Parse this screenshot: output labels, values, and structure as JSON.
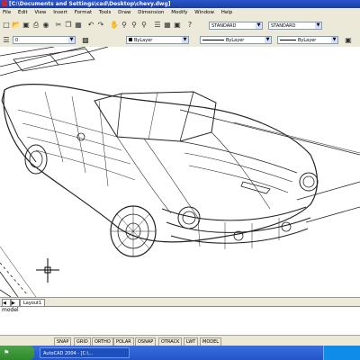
{
  "window": {
    "title": "[C:\\Documents and Settings\\cad\\Desktop\\chevy.dwg]"
  },
  "menu": {
    "items": [
      "File",
      "Edit",
      "View",
      "Insert",
      "Format",
      "Tools",
      "Draw",
      "Dimension",
      "Modify",
      "Window",
      "Help"
    ]
  },
  "toolbar": {
    "text_style": "STANDARD",
    "dim_style": "STANDARD",
    "layer": "0",
    "color": "ByLayer",
    "linetype": "ByLayer",
    "lineweight": "ByLayer"
  },
  "layout_tabs": [
    "Layout1"
  ],
  "command_line": {
    "text": "model"
  },
  "status": {
    "buttons": [
      "SNAP",
      "GRID",
      "ORTHO",
      "POLAR",
      "OSNAP",
      "OTRACK",
      "LWT",
      "MODEL"
    ]
  },
  "taskbar": {
    "item": "AutoCAD 2004 - [C:\\..."
  }
}
